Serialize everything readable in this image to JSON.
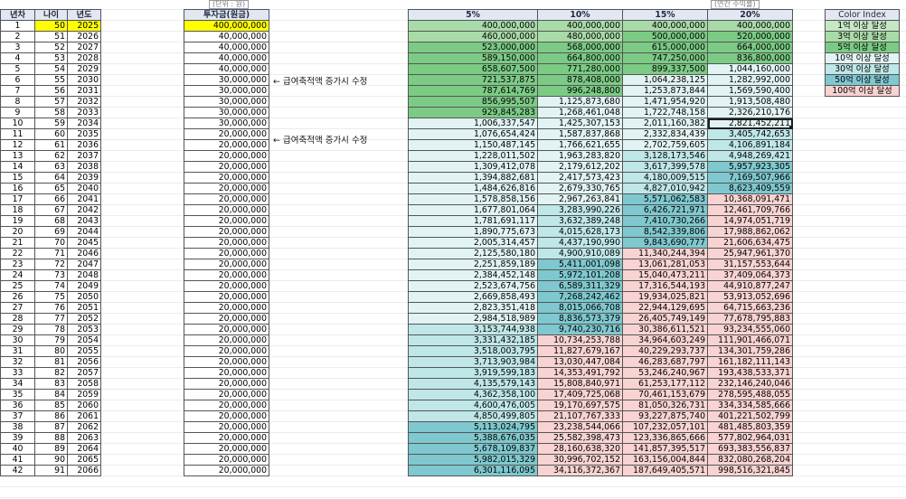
{
  "left_headers": [
    "년차",
    "나이",
    "년도"
  ],
  "rows": [
    [
      1,
      50,
      2025,
      "400,000,000",
      "400,000,000",
      "400,000,000",
      "400,000,000",
      "400,000,000"
    ],
    [
      2,
      51,
      2026,
      "40,000,000",
      "460,000,000",
      "480,000,000",
      "500,000,000",
      "520,000,000"
    ],
    [
      3,
      52,
      2027,
      "40,000,000",
      "523,000,000",
      "568,000,000",
      "615,000,000",
      "664,000,000"
    ],
    [
      4,
      53,
      2028,
      "40,000,000",
      "589,150,000",
      "664,800,000",
      "747,250,000",
      "836,800,000"
    ],
    [
      5,
      54,
      2029,
      "40,000,000",
      "658,607,500",
      "771,280,000",
      "899,337,500",
      "1,044,160,000"
    ],
    [
      6,
      55,
      2030,
      "30,000,000",
      "721,537,875",
      "878,408,000",
      "1,064,238,125",
      "1,282,992,000"
    ],
    [
      7,
      56,
      2031,
      "30,000,000",
      "787,614,769",
      "996,248,800",
      "1,253,873,844",
      "1,569,590,400"
    ],
    [
      8,
      57,
      2032,
      "30,000,000",
      "856,995,507",
      "1,125,873,680",
      "1,471,954,920",
      "1,913,508,480"
    ],
    [
      9,
      58,
      2033,
      "30,000,000",
      "929,845,283",
      "1,268,461,048",
      "1,722,748,158",
      "2,326,210,176"
    ],
    [
      10,
      59,
      2034,
      "30,000,000",
      "1,006,337,547",
      "1,425,307,153",
      "2,011,160,382",
      "2,821,452,211"
    ],
    [
      11,
      60,
      2035,
      "20,000,000",
      "1,076,654,424",
      "1,587,837,868",
      "2,332,834,439",
      "3,405,742,653"
    ],
    [
      12,
      61,
      2036,
      "20,000,000",
      "1,150,487,145",
      "1,766,621,655",
      "2,702,759,605",
      "4,106,891,184"
    ],
    [
      13,
      62,
      2037,
      "20,000,000",
      "1,228,011,502",
      "1,963,283,820",
      "3,128,173,546",
      "4,948,269,421"
    ],
    [
      14,
      63,
      2038,
      "20,000,000",
      "1,309,412,078",
      "2,179,612,202",
      "3,617,399,578",
      "5,957,923,305"
    ],
    [
      15,
      64,
      2039,
      "20,000,000",
      "1,394,882,681",
      "2,417,573,423",
      "4,180,009,515",
      "7,169,507,966"
    ],
    [
      16,
      65,
      2040,
      "20,000,000",
      "1,484,626,816",
      "2,679,330,765",
      "4,827,010,942",
      "8,623,409,559"
    ],
    [
      17,
      66,
      2041,
      "20,000,000",
      "1,578,858,156",
      "2,967,263,841",
      "5,571,062,583",
      "10,368,091,471"
    ],
    [
      18,
      67,
      2042,
      "20,000,000",
      "1,677,801,064",
      "3,283,990,226",
      "6,426,721,971",
      "12,461,709,766"
    ],
    [
      19,
      68,
      2043,
      "20,000,000",
      "1,781,691,117",
      "3,632,389,248",
      "7,410,730,266",
      "14,974,051,719"
    ],
    [
      20,
      69,
      2044,
      "20,000,000",
      "1,890,775,673",
      "4,015,628,173",
      "8,542,339,806",
      "17,988,862,062"
    ],
    [
      21,
      70,
      2045,
      "20,000,000",
      "2,005,314,457",
      "4,437,190,990",
      "9,843,690,777",
      "21,606,634,475"
    ],
    [
      22,
      71,
      2046,
      "20,000,000",
      "2,125,580,180",
      "4,900,910,089",
      "11,340,244,394",
      "25,947,961,370"
    ],
    [
      23,
      72,
      2047,
      "20,000,000",
      "2,251,859,189",
      "5,411,001,098",
      "13,061,281,053",
      "31,157,553,644"
    ],
    [
      24,
      73,
      2048,
      "20,000,000",
      "2,384,452,148",
      "5,972,101,208",
      "15,040,473,211",
      "37,409,064,373"
    ],
    [
      25,
      74,
      2049,
      "20,000,000",
      "2,523,674,756",
      "6,589,311,329",
      "17,316,544,193",
      "44,910,877,247"
    ],
    [
      26,
      75,
      2050,
      "20,000,000",
      "2,669,858,493",
      "7,268,242,462",
      "19,934,025,821",
      "53,913,052,696"
    ],
    [
      27,
      76,
      2051,
      "20,000,000",
      "2,823,351,418",
      "8,015,066,708",
      "22,944,129,695",
      "64,715,663,236"
    ],
    [
      28,
      77,
      2052,
      "20,000,000",
      "2,984,518,989",
      "8,836,573,379",
      "26,405,749,149",
      "77,678,795,883"
    ],
    [
      29,
      78,
      2053,
      "20,000,000",
      "3,153,744,938",
      "9,740,230,716",
      "30,386,611,521",
      "93,234,555,060"
    ],
    [
      30,
      79,
      2054,
      "20,000,000",
      "3,331,432,185",
      "10,734,253,788",
      "34,964,603,249",
      "111,901,466,071"
    ],
    [
      31,
      80,
      2055,
      "20,000,000",
      "3,518,003,795",
      "11,827,679,167",
      "40,229,293,737",
      "134,301,759,286"
    ],
    [
      32,
      81,
      2056,
      "20,000,000",
      "3,713,903,984",
      "13,030,447,084",
      "46,283,687,797",
      "161,182,111,143"
    ],
    [
      33,
      82,
      2057,
      "20,000,000",
      "3,919,599,183",
      "14,353,491,792",
      "53,246,240,967",
      "193,438,533,371"
    ],
    [
      34,
      83,
      2058,
      "20,000,000",
      "4,135,579,143",
      "15,808,840,971",
      "61,253,177,112",
      "232,146,240,046"
    ],
    [
      35,
      84,
      2059,
      "20,000,000",
      "4,362,358,100",
      "17,409,725,068",
      "70,461,153,679",
      "278,595,488,055"
    ],
    [
      36,
      85,
      2060,
      "20,000,000",
      "4,600,476,005",
      "19,170,697,575",
      "81,050,326,731",
      "334,334,585,666"
    ],
    [
      37,
      86,
      2061,
      "20,000,000",
      "4,850,499,805",
      "21,107,767,333",
      "93,227,875,740",
      "401,221,502,799"
    ],
    [
      38,
      87,
      2062,
      "20,000,000",
      "5,113,024,795",
      "23,238,544,066",
      "107,232,057,101",
      "481,485,803,359"
    ],
    [
      39,
      88,
      2063,
      "20,000,000",
      "5,388,676,035",
      "25,582,398,473",
      "123,336,865,666",
      "577,802,964,031"
    ],
    [
      40,
      89,
      2064,
      "20,000,000",
      "5,678,109,837",
      "28,160,638,320",
      "141,857,395,517",
      "693,383,556,837"
    ],
    [
      41,
      90,
      2065,
      "20,000,000",
      "5,982,015,329",
      "30,996,702,152",
      "163,156,004,844",
      "832,080,268,204"
    ],
    [
      42,
      91,
      2066,
      "20,000,000",
      "6,301,116,095",
      "34,116,372,367",
      "187,649,405,571",
      "998,516,321,845"
    ]
  ],
  "invest": {
    "header": "투자금(원금)",
    "unit_label": "(단위 : 원)"
  },
  "projection": {
    "headers": [
      "5%",
      "10%",
      "15%",
      "20%"
    ],
    "unit_label": "(연간 수익률)"
  },
  "notes": {
    "note_row6": "← 급여축적액 증가시 수정",
    "note_row11": "← 급여축적액 증가시 수정"
  },
  "legend": {
    "header": "Color Index",
    "items": [
      "1억 이상 달성",
      "3억 이상 달성",
      "5억 이상 달성",
      "10억 이상 달성",
      "30억 이상 달성",
      "50억 이상 달성",
      "100억 이상 달성"
    ]
  },
  "colors": {
    "tier1": "#c6e8c5",
    "tier3": "#a9dba8",
    "tier5": "#7bcb85",
    "tier10": "#e2f3f3",
    "tier30": "#bfe7e8",
    "tier50": "#7fc8cf",
    "tier100": "#f7d3d2",
    "highlight": "#ffff00",
    "header_bg": "#e3e7ef"
  }
}
